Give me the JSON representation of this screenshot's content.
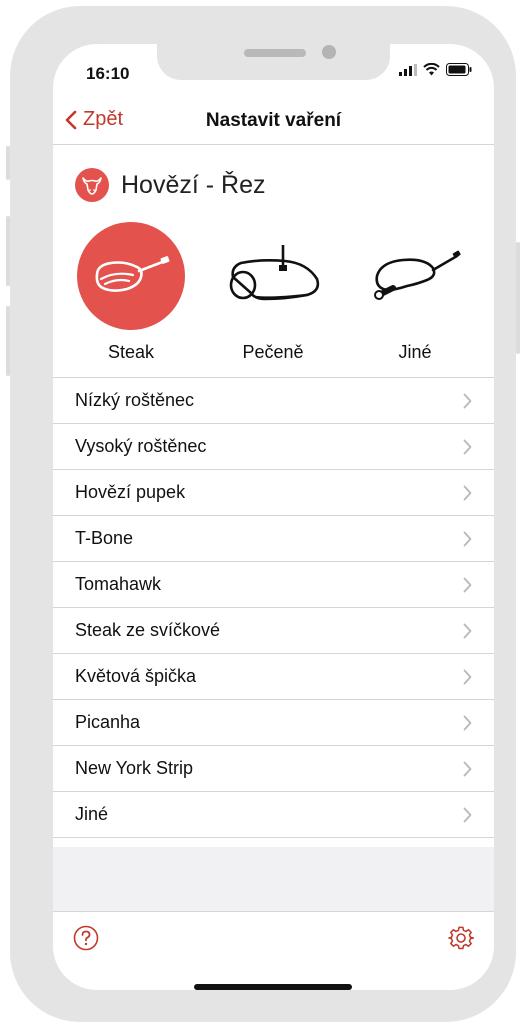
{
  "status_bar": {
    "time": "16:10"
  },
  "nav": {
    "back_label": "Zpět",
    "title": "Nastavit vaření"
  },
  "heading": {
    "text": "Hovězí - Řez",
    "icon": "cow-head-icon"
  },
  "categories": [
    {
      "label": "Steak",
      "icon": "steak-icon",
      "active": true
    },
    {
      "label": "Pečeně",
      "icon": "roast-icon",
      "active": false
    },
    {
      "label": "Jiné",
      "icon": "other-cut-icon",
      "active": false
    }
  ],
  "cuts": [
    "Nízký roštěnec",
    "Vysoký roštěnec",
    "Hovězí pupek",
    "T-Bone",
    "Tomahawk",
    "Steak ze svíčkové",
    "Květová špička",
    "Picanha",
    "New York Strip",
    "Jiné"
  ],
  "toolbar": {
    "help_icon": "question-circle-icon",
    "settings_icon": "gear-icon"
  },
  "colors": {
    "accent": "#e3524d",
    "back": "#c0392b",
    "separator": "#d6d6d6"
  }
}
